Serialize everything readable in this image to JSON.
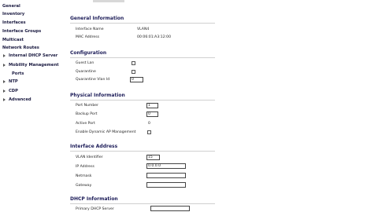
{
  "sidebar": {
    "items": [
      {
        "label": "General"
      },
      {
        "label": "Inventory"
      },
      {
        "label": "Interfaces"
      },
      {
        "label": "Interface Groups"
      },
      {
        "label": "Multicast"
      },
      {
        "label": "Network Routes"
      },
      {
        "label": "Internal DHCP Server"
      },
      {
        "label": "Mobility Management"
      },
      {
        "label": "Ports"
      },
      {
        "label": "NTP"
      },
      {
        "label": "CDP"
      },
      {
        "label": "Advanced"
      }
    ]
  },
  "general_info": {
    "title": "General Information",
    "interface_name_label": "Interface Name",
    "interface_name_value": "VLAN4",
    "mac_label": "MAC Address",
    "mac_value": "00:06:01:A3:12:00"
  },
  "configuration": {
    "title": "Configuration",
    "guest_lan_label": "Guest Lan",
    "quarantine_label": "Quarantine",
    "quarantine_vlan_label": "Quarantine Vlan Id",
    "quarantine_vlan_value": "0"
  },
  "physical": {
    "title": "Physical Information",
    "port_label": "Port Number",
    "port_value": "1",
    "backup_label": "Backup Port",
    "backup_value": "0",
    "active_label": "Active Port",
    "active_value": "0",
    "dynamic_label": "Enable Dynamic AP Management"
  },
  "interface_address": {
    "title": "Interface Address",
    "vlan_label": "VLAN Identifier",
    "vlan_value": "15",
    "ip_label": "IP Address",
    "ip_value": "0.0.0.0",
    "netmask_label": "Netmask",
    "netmask_value": "",
    "gateway_label": "Gateway",
    "gateway_value": ""
  },
  "dhcp": {
    "title": "DHCP Information",
    "primary_label": "Primary DHCP Server",
    "primary_value": ""
  }
}
